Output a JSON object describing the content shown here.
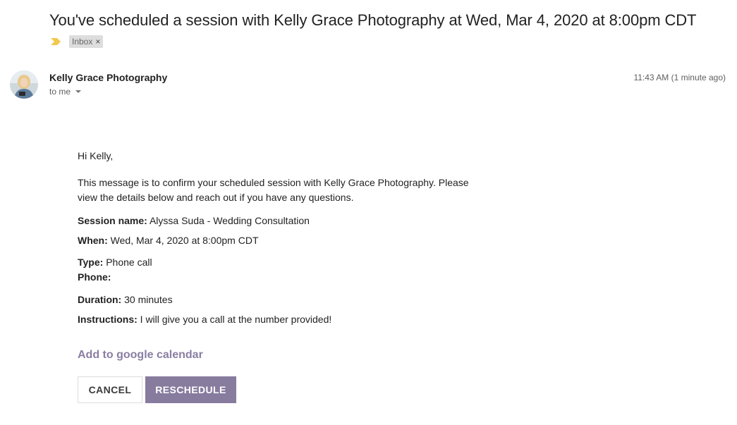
{
  "subject": "You've scheduled a session with Kelly Grace Photography at Wed, Mar 4, 2020 at 8:00pm CDT",
  "labels": {
    "inbox": "Inbox",
    "close_glyph": "×"
  },
  "sender": {
    "name": "Kelly Grace Photography",
    "to": "to me",
    "timestamp": "11:43 AM (1 minute ago)"
  },
  "message": {
    "greeting": "Hi Kelly,",
    "intro": "This message is to confirm your scheduled session with Kelly Grace Photography. Please view the details below and reach out if you have any questions.",
    "details": {
      "session_label": "Session name:",
      "session_value": " Alyssa Suda - Wedding Consultation",
      "when_label": "When:",
      "when_value": " Wed, Mar 4, 2020 at 8:00pm CDT",
      "type_label": "Type:",
      "type_value": " Phone call",
      "phone_label": "Phone:",
      "phone_value": "",
      "duration_label": "Duration:",
      "duration_value": " 30 minutes",
      "instructions_label": "Instructions:",
      "instructions_value": " I will give you a call at the number provided!"
    },
    "calendar_link": "Add to google calendar",
    "cancel_label": "CANCEL",
    "reschedule_label": "RESCHEDULE"
  },
  "colors": {
    "accent": "#877b9e",
    "link": "#8a7ea3",
    "importance": "#f2c94c"
  }
}
